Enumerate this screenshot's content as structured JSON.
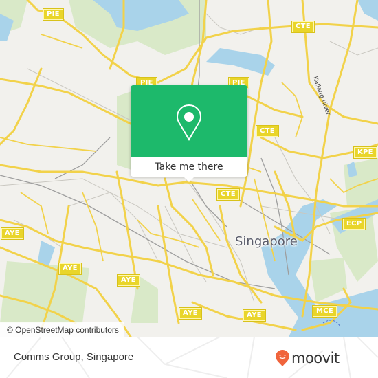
{
  "map": {
    "city_label": "Singapore",
    "river_label": "Kallang River",
    "road_shields": [
      {
        "label": "PIE",
        "id": "pie-1"
      },
      {
        "label": "PIE",
        "id": "pie-2"
      },
      {
        "label": "PIE",
        "id": "pie-3"
      },
      {
        "label": "CTE",
        "id": "cte-1"
      },
      {
        "label": "CTE",
        "id": "cte-2"
      },
      {
        "label": "CTE",
        "id": "cte-3"
      },
      {
        "label": "KPE",
        "id": "kpe-1"
      },
      {
        "label": "ECP",
        "id": "ecp-1"
      },
      {
        "label": "AYE",
        "id": "aye-1"
      },
      {
        "label": "AYE",
        "id": "aye-2"
      },
      {
        "label": "AYE",
        "id": "aye-3"
      },
      {
        "label": "AYE",
        "id": "aye-4"
      },
      {
        "label": "AYE",
        "id": "aye-5"
      },
      {
        "label": "MCE",
        "id": "mce-1"
      }
    ],
    "colors": {
      "land": "#f2f1ed",
      "park": "#d6e8c4",
      "water": "#a9d3ea",
      "road": "#f5dc5a",
      "popup_green": "#1db96b"
    }
  },
  "popup": {
    "icon": "map-pin-icon",
    "action_label": "Take me there"
  },
  "attribution": "© OpenStreetMap contributors",
  "footer": {
    "place_name": "Comms Group, Singapore",
    "brand": "moovit",
    "brand_icon": "moovit-pin-smiley-icon",
    "brand_color": "#f0643c"
  }
}
